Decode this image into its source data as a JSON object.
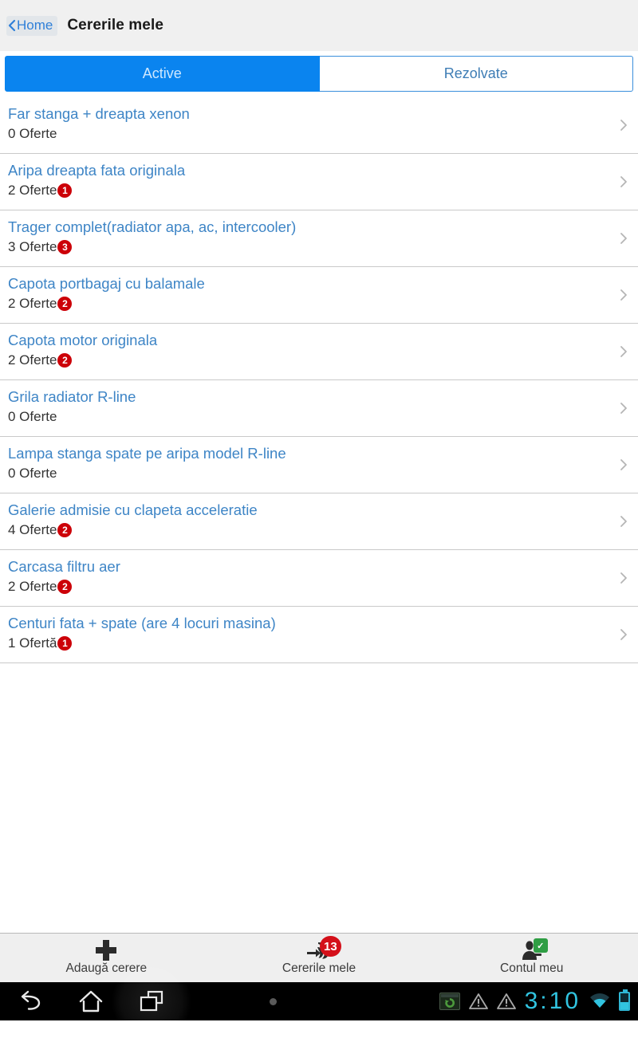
{
  "header": {
    "back_label": "Home",
    "back_icon": "chevron-left-icon",
    "title": "Cererile mele"
  },
  "tabs": [
    {
      "label": "Active",
      "active": true
    },
    {
      "label": "Rezolvate",
      "active": false
    }
  ],
  "colors": {
    "accent_blue": "#0a84ef",
    "link_blue": "#3e85c6",
    "badge_red": "#cc0008",
    "nav_badge_red": "#d4101a",
    "check_green": "#2f9e44",
    "header_bg": "#f0f0f0",
    "status_cyan": "#31c4e0"
  },
  "requests": [
    {
      "title": "Far stanga + dreapta xenon",
      "offers": "0 Oferte",
      "badge": ""
    },
    {
      "title": "Aripa dreapta fata originala",
      "offers": "2 Oferte",
      "badge": "1"
    },
    {
      "title": "Trager complet(radiator apa, ac, intercooler)",
      "offers": "3 Oferte",
      "badge": "3"
    },
    {
      "title": "Capota portbagaj cu balamale",
      "offers": "2 Oferte",
      "badge": "2"
    },
    {
      "title": "Capota motor originala",
      "offers": "2 Oferte",
      "badge": "2"
    },
    {
      "title": "Grila radiator R-line",
      "offers": "0 Oferte",
      "badge": ""
    },
    {
      "title": "Lampa stanga spate pe aripa model R-line",
      "offers": "0 Oferte",
      "badge": ""
    },
    {
      "title": "Galerie admisie cu clapeta acceleratie",
      "offers": "4 Oferte",
      "badge": "2"
    },
    {
      "title": "Carcasa filtru aer",
      "offers": "2 Oferte",
      "badge": "2"
    },
    {
      "title": "Centuri fata + spate (are 4 locuri masina)",
      "offers": "1 Ofertă",
      "badge": "1"
    }
  ],
  "bottom_nav": [
    {
      "label": "Adaugă cerere",
      "icon": "plus-icon",
      "badge": ""
    },
    {
      "label": "Cererile mele",
      "icon": "inbox-arrow-icon",
      "badge": "13"
    },
    {
      "label": "Contul meu",
      "icon": "user-check-icon",
      "badge": ""
    }
  ],
  "system_bar": {
    "back_icon": "back-arrow-icon",
    "home_icon": "home-icon",
    "recents_icon": "recent-apps-icon",
    "menu_dot_icon": "menu-dot-icon",
    "sync_icon": "sync-status-icon",
    "warning_icon_1": "warning-triangle-icon",
    "warning_icon_2": "warning-triangle-icon",
    "clock": "3:10",
    "wifi_icon": "wifi-icon",
    "battery_icon": "battery-icon"
  }
}
